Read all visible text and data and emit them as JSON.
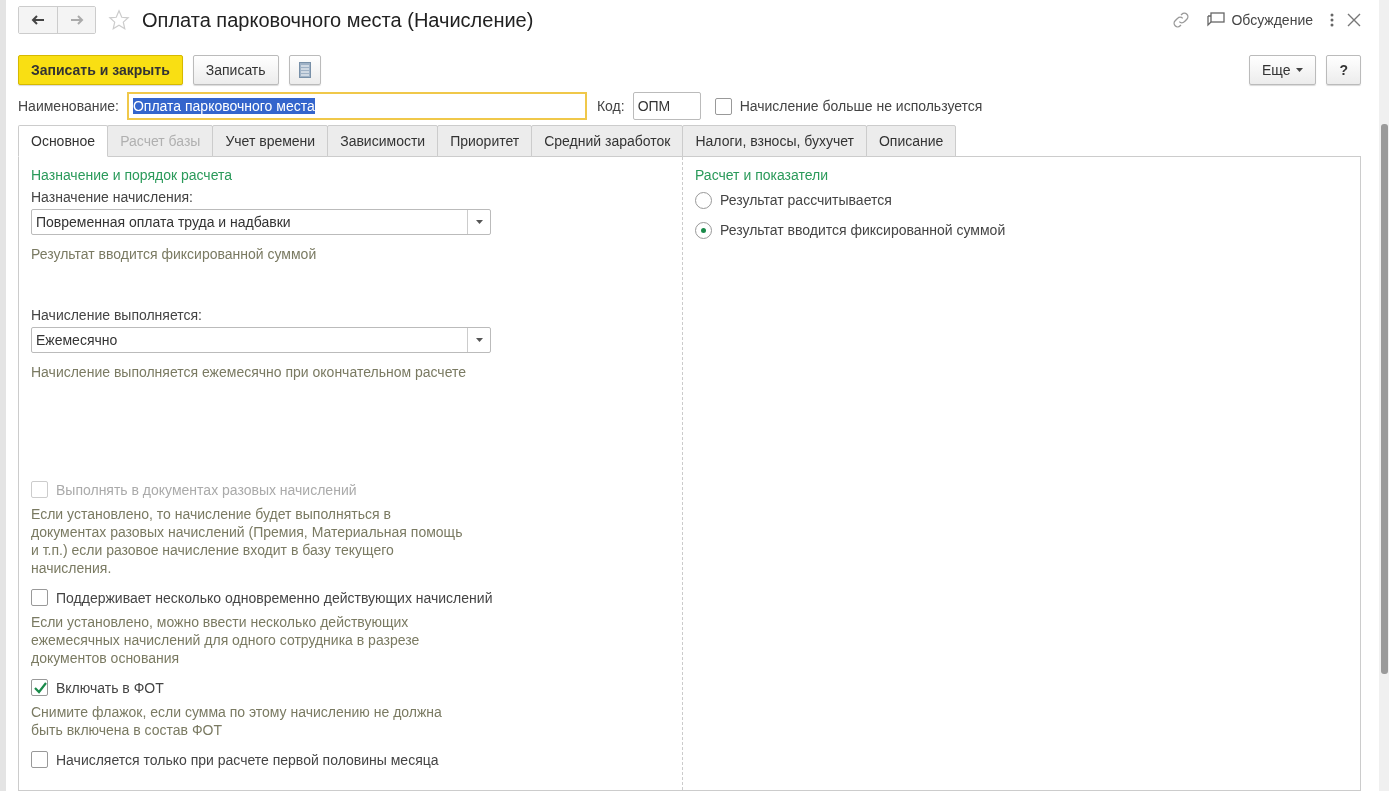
{
  "window": {
    "title": "Оплата парковочного места (Начисление)",
    "favorite": false,
    "discussion": "Обсуждение"
  },
  "toolbar": {
    "buttons": [
      {
        "label": "Записать и закрыть",
        "kind": "primary"
      },
      {
        "label": "Записать",
        "kind": "normal"
      },
      {
        "kind": "report"
      }
    ],
    "more": "Еще",
    "help": "?"
  },
  "header": {
    "name_label": "Наименование:",
    "name_value": "Оплата парковочного места",
    "code_label": "Код:",
    "code_value": "ОПМ",
    "not_used": {
      "label": "Начисление больше не используется",
      "checked": false
    }
  },
  "tabs": [
    {
      "label": "Основное",
      "selected": true,
      "disabled": false
    },
    {
      "label": "Расчет базы",
      "selected": false,
      "disabled": true
    },
    {
      "label": "Учет времени",
      "selected": false,
      "disabled": false
    },
    {
      "label": "Зависимости",
      "selected": false,
      "disabled": false
    },
    {
      "label": "Приоритет",
      "selected": false,
      "disabled": false
    },
    {
      "label": "Средний заработок",
      "selected": false,
      "disabled": false
    },
    {
      "label": "Налоги, взносы, бухучет",
      "selected": false,
      "disabled": false
    },
    {
      "label": "Описание",
      "selected": false,
      "disabled": false
    }
  ],
  "left": {
    "section_title": "Назначение и порядок расчета",
    "fields": [
      {
        "label": "Назначение начисления:",
        "value": "Повременная оплата труда и надбавки",
        "hint": "Результат вводится фиксированной суммой"
      },
      {
        "label": "Начисление выполняется:",
        "value": "Ежемесячно",
        "hint": "Начисление выполняется ежемесячно при окончательном расчете"
      }
    ],
    "options": [
      {
        "label": "Выполнять в документах разовых начислений",
        "checked": false,
        "disabled": true,
        "hint": "Если установлено, то начисление будет выполняться в документах разовых начислений (Премия, Материальная помощь и т.п.) если разовое начисление входит в базу текущего начисления."
      },
      {
        "label": "Поддерживает несколько одновременно действующих начислений",
        "checked": false,
        "disabled": false,
        "hint": "Если установлено, можно ввести несколько действующих ежемесячных начислений для одного сотрудника в разрезе документов основания"
      },
      {
        "label": "Включать в ФОТ",
        "checked": true,
        "disabled": false,
        "hint": "Снимите флажок, если сумма по этому начислению не должна быть включена в состав ФОТ"
      },
      {
        "label": "Начисляется только при расчете первой половины месяца",
        "checked": false,
        "disabled": false
      }
    ]
  },
  "right": {
    "section_title": "Расчет и показатели",
    "radios": [
      {
        "label": "Результат рассчитывается",
        "selected": false
      },
      {
        "label": "Результат вводится фиксированной суммой",
        "selected": true
      }
    ]
  }
}
